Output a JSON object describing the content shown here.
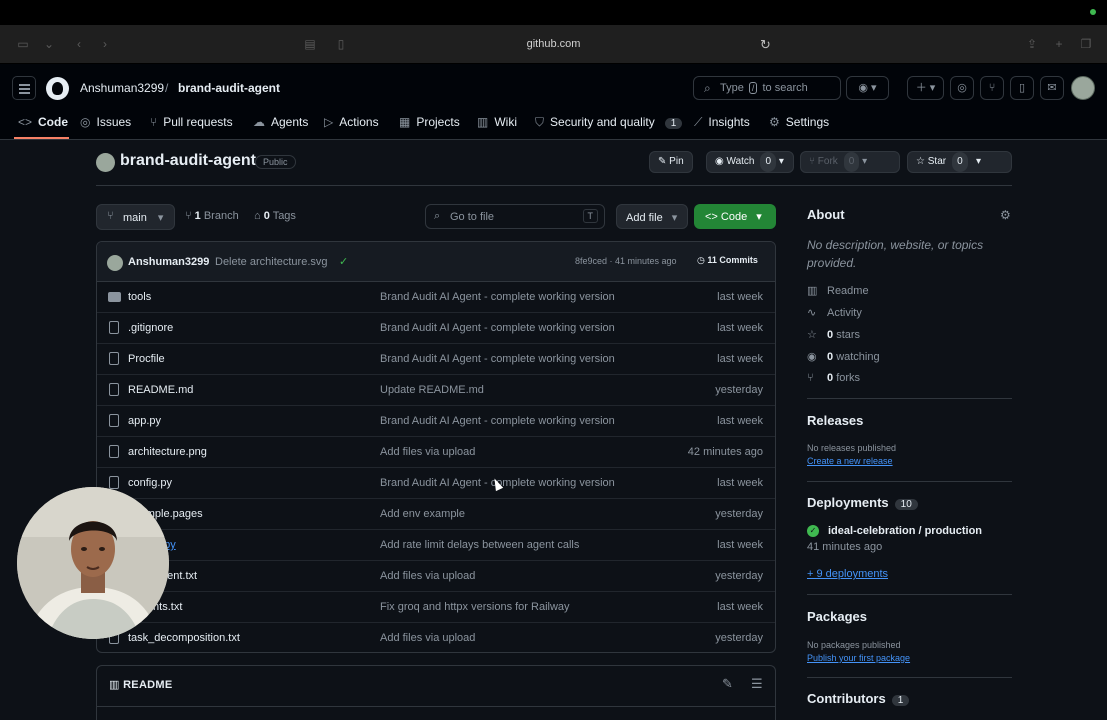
{
  "browser": {
    "url": "github.com"
  },
  "header": {
    "owner": "Anshuman3299",
    "separator": "/",
    "repo": "brand-audit-agent",
    "search_prefix": "Type",
    "search_key": "/",
    "search_suffix": "to search"
  },
  "tabs": [
    {
      "label": "Code",
      "icon": "code-icon"
    },
    {
      "label": "Issues",
      "icon": "issue-icon"
    },
    {
      "label": "Pull requests",
      "icon": "pull-request-icon"
    },
    {
      "label": "Agents",
      "icon": "agent-icon"
    },
    {
      "label": "Actions",
      "icon": "play-icon"
    },
    {
      "label": "Projects",
      "icon": "table-icon"
    },
    {
      "label": "Wiki",
      "icon": "book-icon"
    },
    {
      "label": "Security and quality",
      "icon": "shield-icon",
      "count": "1"
    },
    {
      "label": "Insights",
      "icon": "graph-icon"
    },
    {
      "label": "Settings",
      "icon": "gear-icon"
    }
  ],
  "repo_head": {
    "title": "brand-audit-agent",
    "visibility": "Public",
    "pin": "Pin",
    "watch": "Watch",
    "watch_count": "0",
    "fork": "Fork",
    "fork_count": "0",
    "star": "Star",
    "star_count": "0"
  },
  "toolbar": {
    "branch": "main",
    "branch_count": "1",
    "branch_label": "Branch",
    "tag_count": "0",
    "tag_label": "Tags",
    "goto_placeholder": "Go to file",
    "goto_key": "T",
    "add_file": "Add file",
    "code": "Code"
  },
  "commit": {
    "author": "Anshuman3299",
    "message": "Delete architecture.svg",
    "hash_time": "8fe9ced · 41 minutes ago",
    "commits": "11 Commits"
  },
  "files": [
    {
      "name": "tools",
      "type": "folder",
      "message": "Brand Audit AI Agent - complete working version",
      "date": "last week"
    },
    {
      "name": ".gitignore",
      "type": "file",
      "message": "Brand Audit AI Agent - complete working version",
      "date": "last week"
    },
    {
      "name": "Procfile",
      "type": "file",
      "message": "Brand Audit AI Agent - complete working version",
      "date": "last week"
    },
    {
      "name": "README.md",
      "type": "file",
      "message": "Update README.md",
      "date": "yesterday"
    },
    {
      "name": "app.py",
      "type": "file",
      "message": "Brand Audit AI Agent - complete working version",
      "date": "last week"
    },
    {
      "name": "architecture.png",
      "type": "file",
      "message": "Add files via upload",
      "date": "42 minutes ago"
    },
    {
      "name": "config.py",
      "type": "file",
      "message": "Brand Audit AI Agent - complete working version",
      "date": "last week"
    },
    {
      "name": "example.pages",
      "type": "file",
      "message": "Add env example",
      "date": "yesterday"
    },
    {
      "name": "agents.py",
      "type": "file",
      "link": true,
      "message": "Add rate limit delays between agent calls",
      "date": "last week"
    },
    {
      "name": "_statement.txt",
      "type": "file",
      "message": "Add files via upload",
      "date": "yesterday"
    },
    {
      "name": "rements.txt",
      "type": "file",
      "message": "Fix groq and httpx versions for Railway",
      "date": "last week"
    },
    {
      "name": "task_decomposition.txt",
      "type": "file",
      "message": "Add files via upload",
      "date": "yesterday"
    }
  ],
  "readme": {
    "label": "README"
  },
  "sidebar": {
    "about": "About",
    "about_desc": "No description, website, or topics provided.",
    "readme": "Readme",
    "activity": "Activity",
    "stars_n": "0",
    "stars": "stars",
    "watching_n": "0",
    "watching": "watching",
    "forks_n": "0",
    "forks": "forks",
    "releases": "Releases",
    "no_releases": "No releases published",
    "create_release": "Create a new release",
    "deployments": "Deployments",
    "deployments_count": "10",
    "deploy_name": "ideal-celebration / production",
    "deploy_time": "41 minutes ago",
    "more_deploys": "+ 9 deployments",
    "packages": "Packages",
    "no_packages": "No packages published",
    "publish_package": "Publish your first package",
    "contributors": "Contributors",
    "contributors_count": "1"
  }
}
